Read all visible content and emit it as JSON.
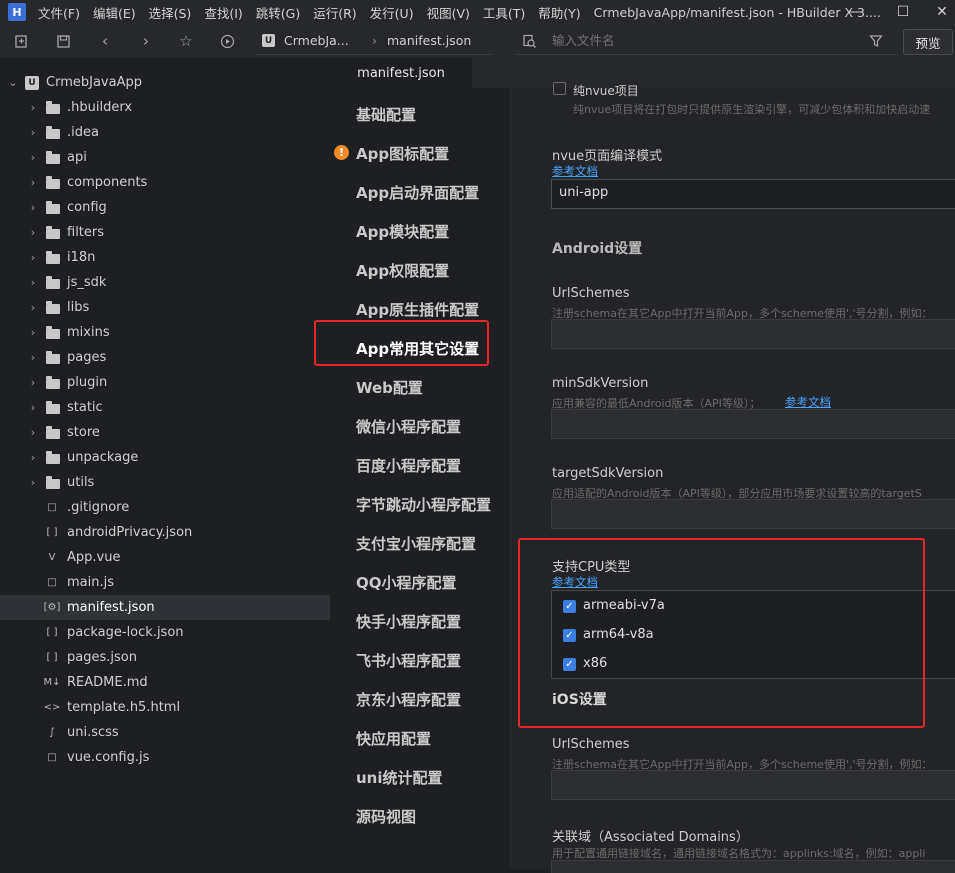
{
  "titlebar": {
    "logo": "H",
    "menus": [
      "文件(F)",
      "编辑(E)",
      "选择(S)",
      "查找(I)",
      "跳转(G)",
      "运行(R)",
      "发行(U)",
      "视图(V)",
      "工具(T)",
      "帮助(Y)"
    ],
    "window_title": "CrmebJavaApp/manifest.json - HBuilder X 3...."
  },
  "toolbar": {
    "breadcrumb_project": "CrmebJa...",
    "breadcrumb_file": "manifest.json",
    "search_placeholder": "输入文件名",
    "preview_label": "预览"
  },
  "tree": {
    "root": "CrmebJavaApp",
    "folders": [
      ".hbuilderx",
      ".idea",
      "api",
      "components",
      "config",
      "filters",
      "i18n",
      "js_sdk",
      "libs",
      "mixins",
      "pages",
      "plugin",
      "static",
      "store",
      "unpackage",
      "utils"
    ],
    "files": [
      {
        "name": ".gitignore",
        "icon": "file-icon"
      },
      {
        "name": "androidPrivacy.json",
        "icon": "json-icon"
      },
      {
        "name": "App.vue",
        "icon": "vue-icon"
      },
      {
        "name": "main.js",
        "icon": "js-icon"
      },
      {
        "name": "manifest.json",
        "icon": "manifest-icon"
      },
      {
        "name": "package-lock.json",
        "icon": "json-icon"
      },
      {
        "name": "pages.json",
        "icon": "json-icon"
      },
      {
        "name": "README.md",
        "icon": "markdown-icon"
      },
      {
        "name": "template.h5.html",
        "icon": "html-icon"
      },
      {
        "name": "uni.scss",
        "icon": "sass-icon"
      },
      {
        "name": "vue.config.js",
        "icon": "js-icon"
      }
    ],
    "selected": "manifest.json"
  },
  "editor": {
    "tab_label": "manifest.json"
  },
  "nav": {
    "items": [
      "基础配置",
      "App图标配置",
      "App启动界面配置",
      "App模块配置",
      "App权限配置",
      "App原生插件配置",
      "App常用其它设置",
      "Web配置",
      "微信小程序配置",
      "百度小程序配置",
      "字节跳动小程序配置",
      "支付宝小程序配置",
      "QQ小程序配置",
      "快手小程序配置",
      "飞书小程序配置",
      "京东小程序配置",
      "快应用配置",
      "uni统计配置",
      "源码视图"
    ],
    "active": "App常用其它设置",
    "warning_item": "App图标配置",
    "warning_glyph": "!"
  },
  "content": {
    "nvue_checkbox_label": "纯nvue项目",
    "nvue_hint": "纯nvue项目将在打包时只提供原生渲染引擎，可减少包体积和加快启动速",
    "nvue_mode_label": "nvue页面编译模式",
    "ref_doc": "参考文档",
    "nvue_mode_value": "uni-app",
    "android_section": "Android设置",
    "urlschemes_label": "UrlSchemes",
    "urlschemes_hint": "注册schema在其它App中打开当前App，多个scheme使用','号分割，例如：",
    "minsdk_label": "minSdkVersion",
    "minsdk_hint": "应用兼容的最低Android版本（API等级）；",
    "targetsdk_label": "targetSdkVersion",
    "targetsdk_hint": "应用适配的Android版本（API等级），部分应用市场要求设置较高的targetS",
    "cpu_label": "支持CPU类型",
    "cpu_options": [
      "armeabi-v7a",
      "arm64-v8a",
      "x86"
    ],
    "check_glyph": "✓",
    "ios_section": "iOS设置",
    "ios_urlschemes_label": "UrlSchemes",
    "ios_urlschemes_hint": "注册schema在其它App中打开当前App，多个scheme使用','号分割，例如：",
    "assoc_label": "关联域（Associated Domains）",
    "assoc_hint": "用于配置通用链接域名，通用链接域名格式为：applinks:域名，例如：appli"
  }
}
